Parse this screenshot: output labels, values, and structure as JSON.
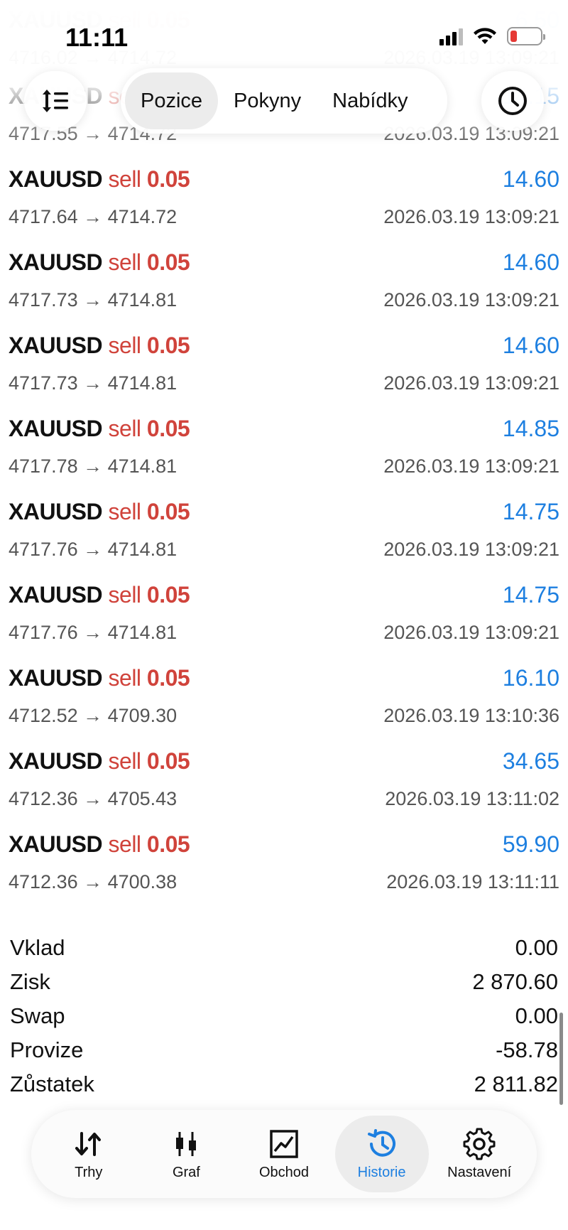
{
  "status_bar": {
    "time": "11:11"
  },
  "toolbar": {
    "sort_icon": "sort-icon",
    "tabs": [
      {
        "label": "Pozice",
        "active": true
      },
      {
        "label": "Pokyny",
        "active": false
      },
      {
        "label": "Nabídky",
        "active": false
      }
    ],
    "history_icon": "clock-icon"
  },
  "deals": [
    {
      "symbol": "XAUUSD",
      "side": "sell",
      "volume": "0.05",
      "profit": "6.50",
      "prices": "4716.02 → 4714.72",
      "time": "2026.03.19 13:09:21",
      "faded": true
    },
    {
      "symbol": "XAUUSD",
      "side": "sell",
      "volume": "0.05",
      "profit": "14.15",
      "prices": "4717.55 → 4714.72",
      "time": "2026.03.19 13:09:21",
      "faded": false
    },
    {
      "symbol": "XAUUSD",
      "side": "sell",
      "volume": "0.05",
      "profit": "14.60",
      "prices": "4717.64 → 4714.72",
      "time": "2026.03.19 13:09:21",
      "faded": false
    },
    {
      "symbol": "XAUUSD",
      "side": "sell",
      "volume": "0.05",
      "profit": "14.60",
      "prices": "4717.73 → 4714.81",
      "time": "2026.03.19 13:09:21",
      "faded": false
    },
    {
      "symbol": "XAUUSD",
      "side": "sell",
      "volume": "0.05",
      "profit": "14.60",
      "prices": "4717.73 → 4714.81",
      "time": "2026.03.19 13:09:21",
      "faded": false
    },
    {
      "symbol": "XAUUSD",
      "side": "sell",
      "volume": "0.05",
      "profit": "14.85",
      "prices": "4717.78 → 4714.81",
      "time": "2026.03.19 13:09:21",
      "faded": false
    },
    {
      "symbol": "XAUUSD",
      "side": "sell",
      "volume": "0.05",
      "profit": "14.75",
      "prices": "4717.76 → 4714.81",
      "time": "2026.03.19 13:09:21",
      "faded": false
    },
    {
      "symbol": "XAUUSD",
      "side": "sell",
      "volume": "0.05",
      "profit": "14.75",
      "prices": "4717.76 → 4714.81",
      "time": "2026.03.19 13:09:21",
      "faded": false
    },
    {
      "symbol": "XAUUSD",
      "side": "sell",
      "volume": "0.05",
      "profit": "16.10",
      "prices": "4712.52 → 4709.30",
      "time": "2026.03.19 13:10:36",
      "faded": false
    },
    {
      "symbol": "XAUUSD",
      "side": "sell",
      "volume": "0.05",
      "profit": "34.65",
      "prices": "4712.36 → 4705.43",
      "time": "2026.03.19 13:11:02",
      "faded": false
    },
    {
      "symbol": "XAUUSD",
      "side": "sell",
      "volume": "0.05",
      "profit": "59.90",
      "prices": "4712.36 → 4700.38",
      "time": "2026.03.19 13:11:11",
      "faded": false
    }
  ],
  "summary": [
    {
      "label": "Vklad",
      "value": "0.00"
    },
    {
      "label": "Zisk",
      "value": "2 870.60"
    },
    {
      "label": "Swap",
      "value": "0.00"
    },
    {
      "label": "Provize",
      "value": "-58.78"
    },
    {
      "label": "Zůstatek",
      "value": "2 811.82"
    }
  ],
  "tabbar": {
    "items": [
      {
        "label": "Trhy",
        "icon": "arrows-updown-icon",
        "active": false
      },
      {
        "label": "Graf",
        "icon": "candlestick-icon",
        "active": false
      },
      {
        "label": "Obchod",
        "icon": "trade-chart-icon",
        "active": false
      },
      {
        "label": "Historie",
        "icon": "history-icon",
        "active": true
      },
      {
        "label": "Nastavení",
        "icon": "gear-icon",
        "active": false
      }
    ]
  },
  "colors": {
    "sell": "#d0433b",
    "profit": "#1d7fe0",
    "active_tab": "#1d7fe0",
    "battery_low": "#e53935"
  }
}
